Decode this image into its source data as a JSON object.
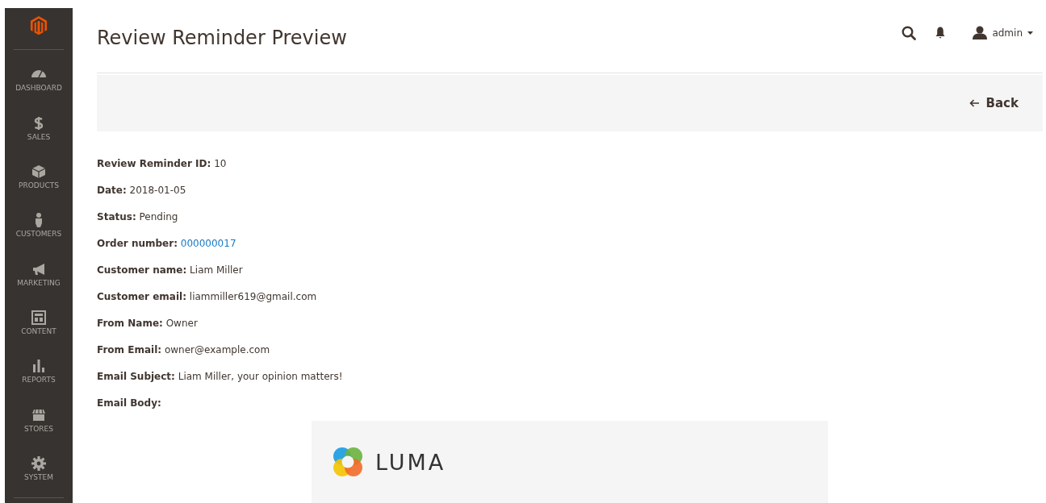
{
  "sidebar": {
    "items": [
      {
        "kind": "dashboard",
        "label": "DASHBOARD"
      },
      {
        "kind": "sales",
        "label": "SALES"
      },
      {
        "kind": "products",
        "label": "PRODUCTS"
      },
      {
        "kind": "customers",
        "label": "CUSTOMERS"
      },
      {
        "kind": "marketing",
        "label": "MARKETING"
      },
      {
        "kind": "content",
        "label": "CONTENT"
      },
      {
        "kind": "reports",
        "label": "REPORTS"
      },
      {
        "kind": "stores",
        "label": "STORES"
      },
      {
        "kind": "system",
        "label": "SYSTEM"
      }
    ]
  },
  "header": {
    "title": "Review Reminder Preview",
    "user": "admin"
  },
  "actions": {
    "back": "Back"
  },
  "details": [
    {
      "kind": "text",
      "label": "Review Reminder ID:",
      "value": "10"
    },
    {
      "kind": "text",
      "label": "Date:",
      "value": "2018-01-05"
    },
    {
      "kind": "text",
      "label": "Status:",
      "value": "Pending"
    },
    {
      "kind": "link",
      "label": "Order number:",
      "value": "000000017"
    },
    {
      "kind": "text",
      "label": "Customer name:",
      "value": "Liam Miller"
    },
    {
      "kind": "text",
      "label": "Customer email:",
      "value": "liammiller619@gmail.com"
    },
    {
      "kind": "text",
      "label": "From Name:",
      "value": "Owner"
    },
    {
      "kind": "text",
      "label": "From Email:",
      "value": "owner@example.com"
    },
    {
      "kind": "text",
      "label": "Email Subject:",
      "value": "Liam Miller, your opinion matters!"
    },
    {
      "kind": "heading",
      "label": "Email Body:"
    }
  ],
  "email_body": {
    "brand": "LUMA"
  }
}
